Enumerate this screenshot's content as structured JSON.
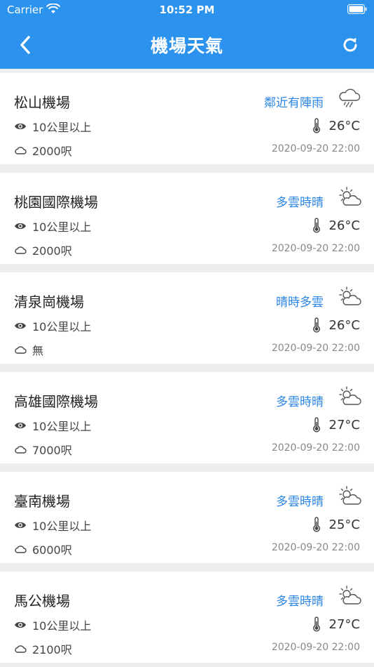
{
  "status": {
    "carrier": "Carrier",
    "time": "10:52 PM"
  },
  "nav": {
    "title": "機場天氣"
  },
  "airports": [
    {
      "name": "松山機場",
      "condition": "鄰近有陣雨",
      "icon": "rain-cloud-icon",
      "visibility": "10公里以上",
      "ceiling": "2000呎",
      "temperature": "26°C",
      "updated": "2020-09-20 22:00"
    },
    {
      "name": "桃園國際機場",
      "condition": "多雲時晴",
      "icon": "partly-cloudy-icon",
      "visibility": "10公里以上",
      "ceiling": "2000呎",
      "temperature": "26°C",
      "updated": "2020-09-20 22:00"
    },
    {
      "name": "清泉崗機場",
      "condition": "晴時多雲",
      "icon": "partly-cloudy-icon",
      "visibility": "10公里以上",
      "ceiling": "無",
      "temperature": "26°C",
      "updated": "2020-09-20 22:00"
    },
    {
      "name": "高雄國際機場",
      "condition": "多雲時晴",
      "icon": "partly-cloudy-icon",
      "visibility": "10公里以上",
      "ceiling": "7000呎",
      "temperature": "27°C",
      "updated": "2020-09-20 22:00"
    },
    {
      "name": "臺南機場",
      "condition": "多雲時晴",
      "icon": "partly-cloudy-icon",
      "visibility": "10公里以上",
      "ceiling": "6000呎",
      "temperature": "25°C",
      "updated": "2020-09-20 22:00"
    },
    {
      "name": "馬公機場",
      "condition": "多雲時晴",
      "icon": "partly-cloudy-icon",
      "visibility": "10公里以上",
      "ceiling": "2100呎",
      "temperature": "27°C",
      "updated": "2020-09-20 22:00"
    }
  ],
  "colors": {
    "header": "#2b92ee",
    "accent": "#2b85e6",
    "background": "#eeeeee"
  }
}
